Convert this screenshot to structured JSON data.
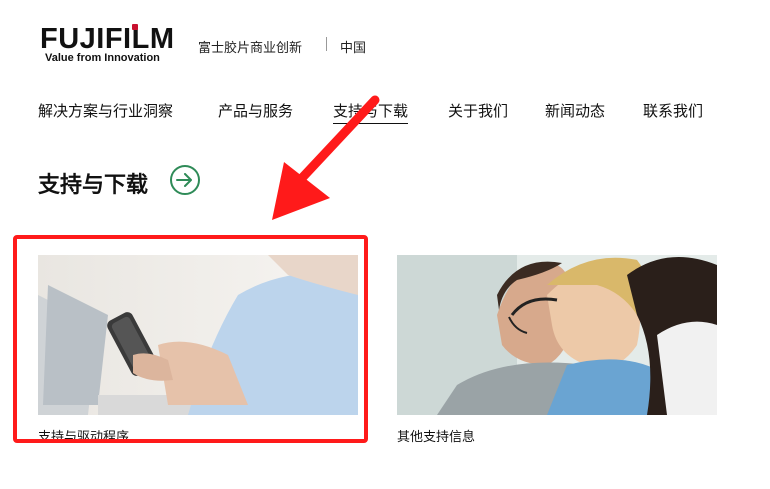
{
  "header": {
    "logo_text": "FUJIFILM",
    "logo_tagline": "Value from Innovation",
    "brand_subtitle": "富士胶片商业创新",
    "region": "中国"
  },
  "nav": {
    "items": [
      {
        "label": "解决方案与行业洞察"
      },
      {
        "label": "产品与服务"
      },
      {
        "label": "支持与下载",
        "active": true
      },
      {
        "label": "关于我们"
      },
      {
        "label": "新闻动态"
      },
      {
        "label": "联系我们"
      }
    ]
  },
  "section": {
    "title": "支持与下载",
    "arrow_icon": "arrow-right-circle-icon",
    "accent_color": "#2f8b58"
  },
  "cards": [
    {
      "label": "支持与驱动程序",
      "image": "person-holding-smartphone-at-laptop"
    },
    {
      "label": "其他支持信息",
      "image": "call-center-agents-with-headsets"
    }
  ],
  "annotation": {
    "highlight_color": "#ff1a1a"
  }
}
